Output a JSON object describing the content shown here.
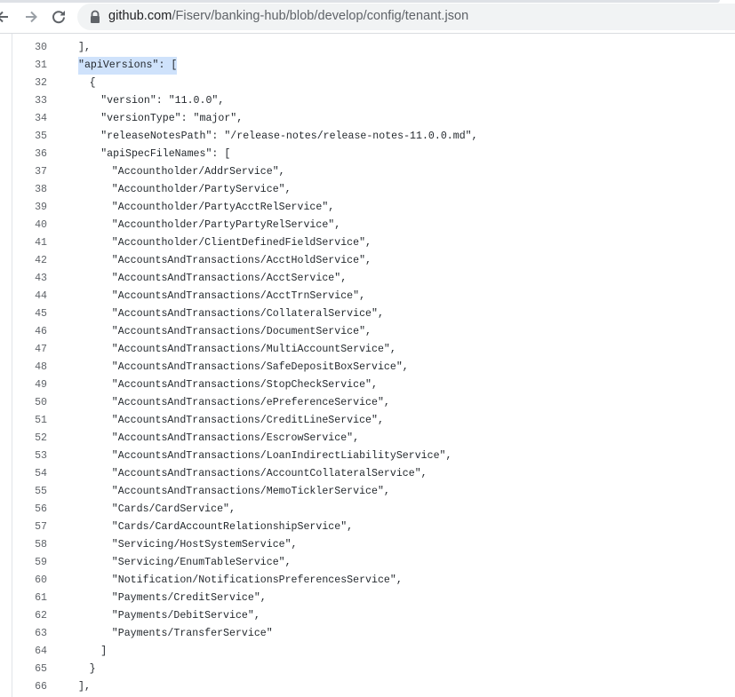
{
  "browser": {
    "url_host": "github.com",
    "url_path": "/Fiserv/banking-hub/blob/develop/config/tenant.json"
  },
  "lines": [
    {
      "num": "30",
      "indent": 0,
      "text": "],",
      "highlight": false
    },
    {
      "num": "31",
      "indent": 0,
      "text": "\"apiVersions\": [",
      "highlight": true
    },
    {
      "num": "32",
      "indent": 1,
      "text": "{",
      "highlight": false
    },
    {
      "num": "33",
      "indent": 2,
      "text": "\"version\": \"11.0.0\",",
      "highlight": false
    },
    {
      "num": "34",
      "indent": 2,
      "text": "\"versionType\": \"major\",",
      "highlight": false
    },
    {
      "num": "35",
      "indent": 2,
      "text": "\"releaseNotesPath\": \"/release-notes/release-notes-11.0.0.md\",",
      "highlight": false
    },
    {
      "num": "36",
      "indent": 2,
      "text": "\"apiSpecFileNames\": [",
      "highlight": false
    },
    {
      "num": "37",
      "indent": 3,
      "text": "\"Accountholder/AddrService\",",
      "highlight": false
    },
    {
      "num": "38",
      "indent": 3,
      "text": "\"Accountholder/PartyService\",",
      "highlight": false
    },
    {
      "num": "39",
      "indent": 3,
      "text": "\"Accountholder/PartyAcctRelService\",",
      "highlight": false
    },
    {
      "num": "40",
      "indent": 3,
      "text": "\"Accountholder/PartyPartyRelService\",",
      "highlight": false
    },
    {
      "num": "41",
      "indent": 3,
      "text": "\"Accountholder/ClientDefinedFieldService\",",
      "highlight": false
    },
    {
      "num": "42",
      "indent": 3,
      "text": "\"AccountsAndTransactions/AcctHoldService\",",
      "highlight": false
    },
    {
      "num": "43",
      "indent": 3,
      "text": "\"AccountsAndTransactions/AcctService\",",
      "highlight": false
    },
    {
      "num": "44",
      "indent": 3,
      "text": "\"AccountsAndTransactions/AcctTrnService\",",
      "highlight": false
    },
    {
      "num": "45",
      "indent": 3,
      "text": "\"AccountsAndTransactions/CollateralService\",",
      "highlight": false
    },
    {
      "num": "46",
      "indent": 3,
      "text": "\"AccountsAndTransactions/DocumentService\",",
      "highlight": false
    },
    {
      "num": "47",
      "indent": 3,
      "text": "\"AccountsAndTransactions/MultiAccountService\",",
      "highlight": false
    },
    {
      "num": "48",
      "indent": 3,
      "text": "\"AccountsAndTransactions/SafeDepositBoxService\",",
      "highlight": false
    },
    {
      "num": "49",
      "indent": 3,
      "text": "\"AccountsAndTransactions/StopCheckService\",",
      "highlight": false
    },
    {
      "num": "50",
      "indent": 3,
      "text": "\"AccountsAndTransactions/ePreferenceService\",",
      "highlight": false
    },
    {
      "num": "51",
      "indent": 3,
      "text": "\"AccountsAndTransactions/CreditLineService\",",
      "highlight": false
    },
    {
      "num": "52",
      "indent": 3,
      "text": "\"AccountsAndTransactions/EscrowService\",",
      "highlight": false
    },
    {
      "num": "53",
      "indent": 3,
      "text": "\"AccountsAndTransactions/LoanIndirectLiabilityService\",",
      "highlight": false
    },
    {
      "num": "54",
      "indent": 3,
      "text": "\"AccountsAndTransactions/AccountCollateralService\",",
      "highlight": false
    },
    {
      "num": "55",
      "indent": 3,
      "text": "\"AccountsAndTransactions/MemoTicklerService\",",
      "highlight": false
    },
    {
      "num": "56",
      "indent": 3,
      "text": "\"Cards/CardService\",",
      "highlight": false
    },
    {
      "num": "57",
      "indent": 3,
      "text": "\"Cards/CardAccountRelationshipService\",",
      "highlight": false
    },
    {
      "num": "58",
      "indent": 3,
      "text": "\"Servicing/HostSystemService\",",
      "highlight": false
    },
    {
      "num": "59",
      "indent": 3,
      "text": "\"Servicing/EnumTableService\",",
      "highlight": false
    },
    {
      "num": "60",
      "indent": 3,
      "text": "\"Notification/NotificationsPreferencesService\",",
      "highlight": false
    },
    {
      "num": "61",
      "indent": 3,
      "text": "\"Payments/CreditService\",",
      "highlight": false
    },
    {
      "num": "62",
      "indent": 3,
      "text": "\"Payments/DebitService\",",
      "highlight": false
    },
    {
      "num": "63",
      "indent": 3,
      "text": "\"Payments/TransferService\"",
      "highlight": false
    },
    {
      "num": "64",
      "indent": 2,
      "text": "]",
      "highlight": false
    },
    {
      "num": "65",
      "indent": 1,
      "text": "}",
      "highlight": false
    },
    {
      "num": "66",
      "indent": 0,
      "text": "],",
      "highlight": false
    }
  ]
}
